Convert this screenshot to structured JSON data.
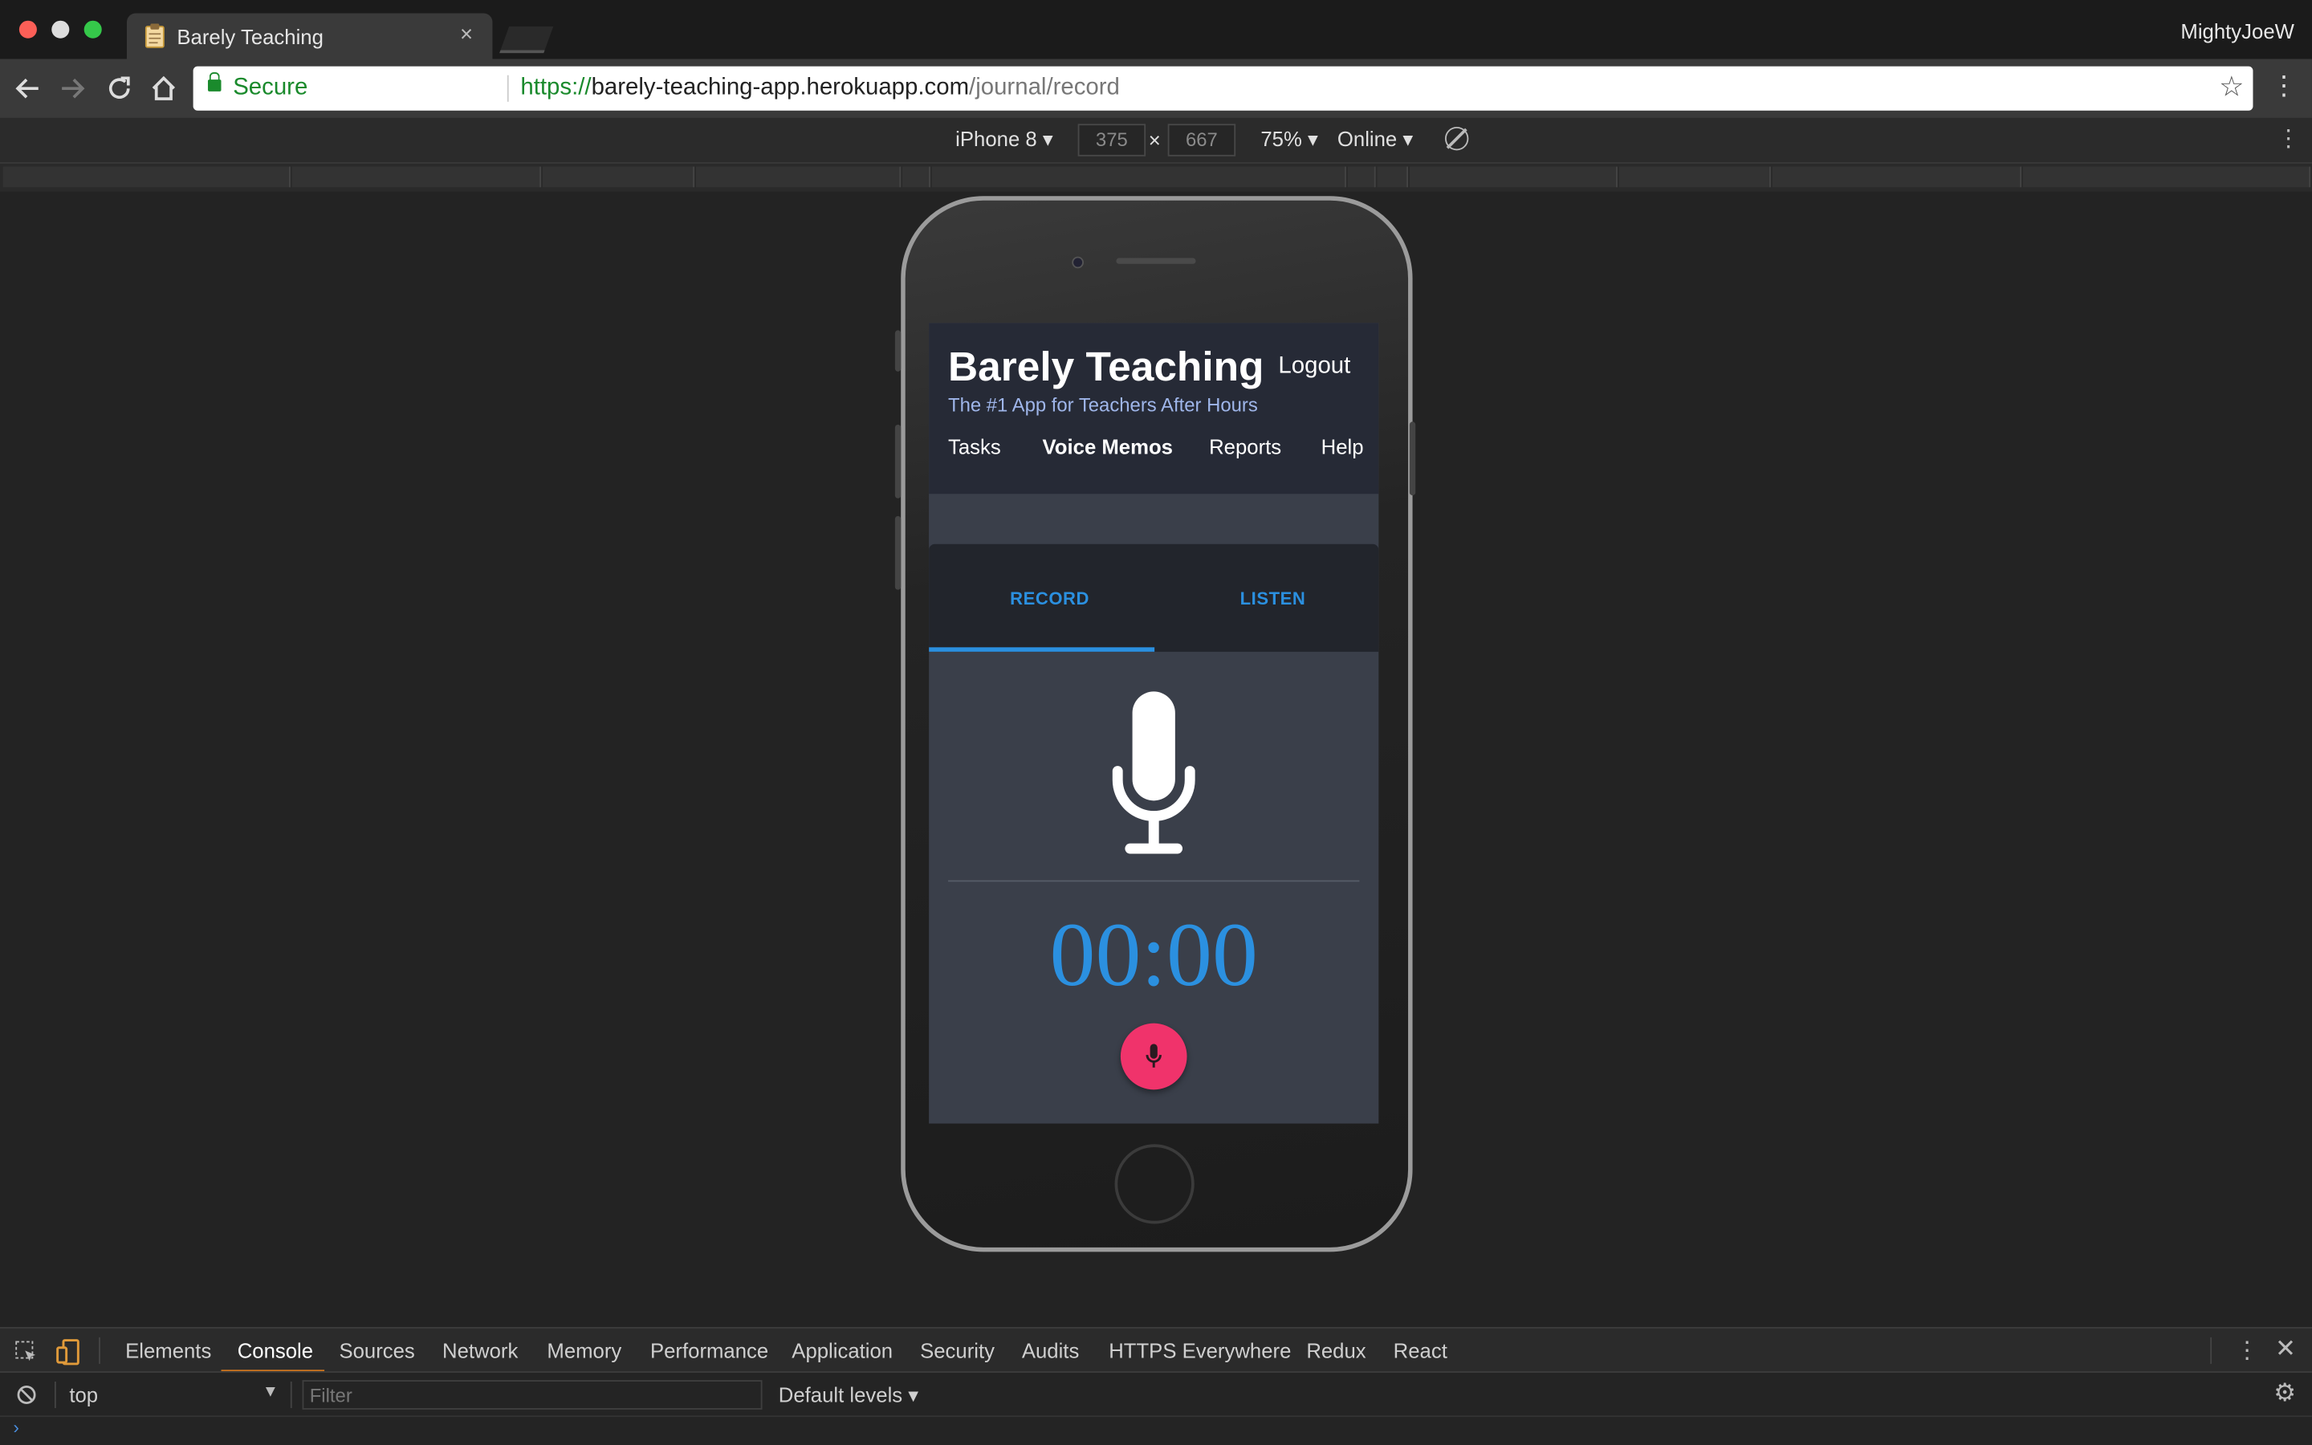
{
  "browser": {
    "tab_title": "Barely Teaching",
    "tab_close": "×",
    "profile_name": "MightyJoeW",
    "security_label": "Secure",
    "url": {
      "scheme": "https://",
      "host": "barely-teaching-app.herokuapp.com",
      "path": "/journal/record"
    }
  },
  "device_toolbar": {
    "device": "iPhone 8",
    "width": "375",
    "times": "×",
    "height": "667",
    "zoom": "75%",
    "network": "Online"
  },
  "app": {
    "title": "Barely Teaching",
    "logout": "Logout",
    "tagline": "The #1 App for Teachers After Hours",
    "nav": [
      "Tasks",
      "Voice Memos",
      "Reports",
      "Help"
    ],
    "active_nav": "Voice Memos",
    "tabs": [
      "RECORD",
      "LISTEN"
    ],
    "active_tab": "RECORD",
    "timer": "00:00",
    "accent_color": "#2b90e0",
    "record_button_color": "#f0336b"
  },
  "devtools": {
    "tabs": [
      "Elements",
      "Console",
      "Sources",
      "Network",
      "Memory",
      "Performance",
      "Application",
      "Security",
      "Audits",
      "HTTPS Everywhere",
      "Redux",
      "React"
    ],
    "active_tab": "Console",
    "context": "top",
    "filter_placeholder": "Filter",
    "levels": "Default levels"
  },
  "icons": [
    "back-arrow-icon",
    "forward-arrow-icon",
    "reload-icon",
    "home-icon",
    "lock-icon",
    "star-icon",
    "kebab-menu-icon",
    "rotate-icon",
    "inspect-icon",
    "device-toggle-icon",
    "microphone-icon",
    "clear-console-icon",
    "settings-gear-icon",
    "close-icon",
    "notepad-favicon"
  ]
}
